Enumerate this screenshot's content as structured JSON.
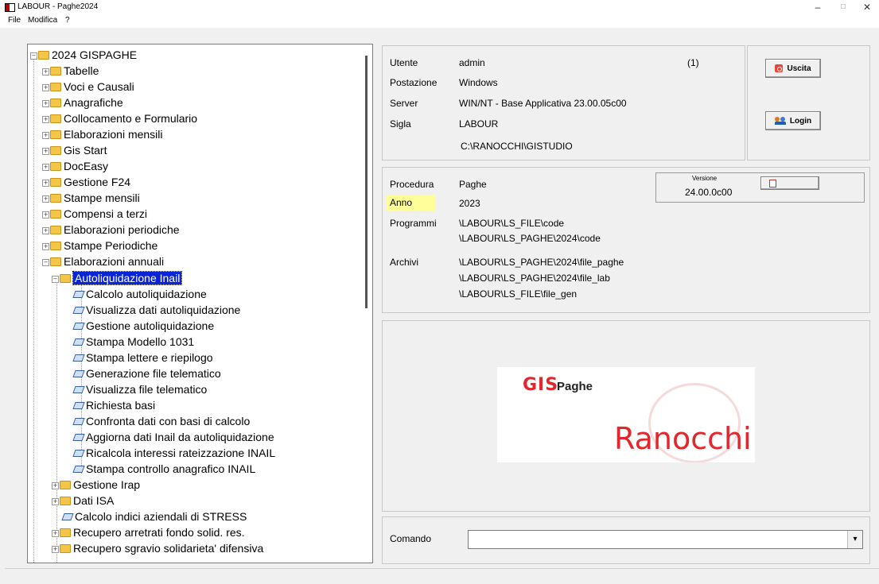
{
  "window": {
    "title": "LABOUR - Paghe2024",
    "minimize": "–",
    "maximize": "□",
    "close": "✕"
  },
  "menu": [
    {
      "label": "File"
    },
    {
      "label": "Modifica"
    },
    {
      "label": "?"
    }
  ],
  "tree": {
    "root": "2024 GISPAGHE",
    "level1": [
      "Tabelle",
      "Voci e Causali",
      "Anagrafiche",
      "Collocamento e Formulario",
      "Elaborazioni mensili",
      "Gis Start",
      "DocEasy",
      "Gestione F24",
      "Stampe mensili",
      "Compensi a terzi",
      "Elaborazioni periodiche",
      "Stampe Periodiche",
      "Elaborazioni annuali"
    ],
    "selected_folder": "Autoliquidazione Inail",
    "leaves": [
      "Calcolo autoliquidazione",
      "Visualizza dati autoliquidazione",
      "Gestione autoliquidazione",
      "Stampa Modello 1031",
      "Stampa lettere e riepilogo",
      "Generazione file telematico",
      "Visualizza file telematico",
      "Richiesta basi",
      "Confronta dati con basi di calcolo",
      "Aggiorna dati Inail da autoliquidazione",
      "Ricalcola interessi rateizzazione INAIL",
      "Stampa controllo anagrafico INAIL"
    ],
    "after": [
      {
        "label": "Gestione Irap",
        "type": "folder"
      },
      {
        "label": "Dati ISA",
        "type": "folder"
      },
      {
        "label": "Calcolo indici aziendali di STRESS",
        "type": "doc"
      },
      {
        "label": "Recupero arretrati fondo solid. res.",
        "type": "folder"
      },
      {
        "label": "Recupero sgravio solidarieta' difensiva",
        "type": "folder"
      }
    ]
  },
  "session": {
    "utente_label": "Utente",
    "utente": "admin",
    "count": "(1)",
    "postazione_label": "Postazione",
    "postazione": "Windows",
    "server_label": "Server",
    "server": "WIN/NT - Base Applicativa 23.00.05c00",
    "sigla_label": "Sigla",
    "sigla": "LABOUR",
    "path": "C:\\RANOCCHI\\GISTUDIO"
  },
  "buttons": {
    "uscita": "Uscita",
    "login": "Login"
  },
  "procedura": {
    "procedura_label": "Procedura",
    "procedura": "Paghe",
    "anno_label": "Anno",
    "anno": "2023",
    "programmi_label": "Programmi",
    "programmi": [
      "\\LABOUR\\LS_FILE\\code",
      "\\LABOUR\\LS_PAGHE\\2024\\code"
    ],
    "archivi_label": "Archivi",
    "archivi": [
      "\\LABOUR\\LS_PAGHE\\2024\\file_paghe",
      "\\LABOUR\\LS_PAGHE\\2024\\file_lab",
      "\\LABOUR\\LS_FILE\\file_gen"
    ],
    "versione_label": "Versione",
    "versione": "24.00.0c00"
  },
  "logo": {
    "gis": "GIS",
    "paghe": "Paghe",
    "brand": "Ranocchi"
  },
  "comando": {
    "label": "Comando",
    "value": ""
  },
  "colors": {
    "selection": "#0a24d8",
    "anno_highlight": "#ffff99",
    "brand_red": "#e3262b"
  }
}
